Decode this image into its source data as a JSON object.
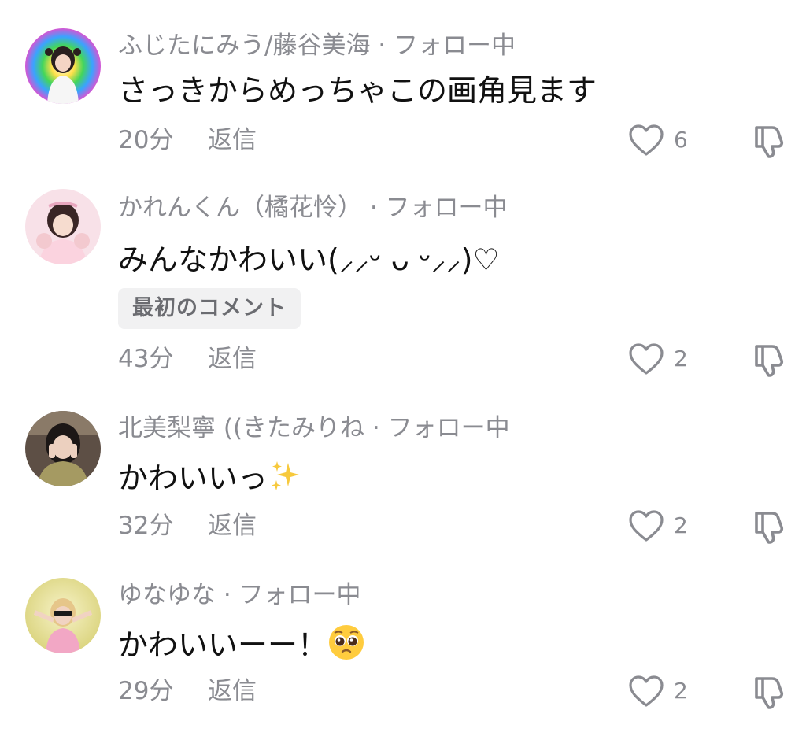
{
  "comments": [
    {
      "author": "ふじたにみう/藤谷美海 · フォロー中",
      "text": "さっきからめっちゃこの画角見ます",
      "badge": "",
      "time": "20分",
      "reply_label": "返信",
      "likes": "6",
      "avatar_bg": "#e84fbf"
    },
    {
      "author": "かれんくん（橘花怜） · フォロー中",
      "text": "みんなかわいい(⸝⸝ᵕ ᴗ ᵕ⸝⸝)♡",
      "badge": "最初のコメント",
      "time": "43分",
      "reply_label": "返信",
      "likes": "2",
      "avatar_bg": "#f6d9e3"
    },
    {
      "author": "北美梨寧 ((きたみりね · フォロー中",
      "text": "かわいいっ",
      "text_emoji": "sparkles",
      "badge": "",
      "time": "32分",
      "reply_label": "返信",
      "likes": "2",
      "avatar_bg": "#6d5a4a"
    },
    {
      "author": "ゆなゆな · フォロー中",
      "text": "かわいいーー！",
      "text_emoji": "pleading-face",
      "badge": "",
      "time": "29分",
      "reply_label": "返信",
      "likes": "2",
      "avatar_bg": "#e9e39a"
    }
  ],
  "icons": {
    "like": "heart-outline-icon",
    "dislike": "thumbs-down-icon"
  },
  "colors": {
    "secondary_text": "#8a8b91",
    "badge_bg": "#f1f1f2"
  }
}
